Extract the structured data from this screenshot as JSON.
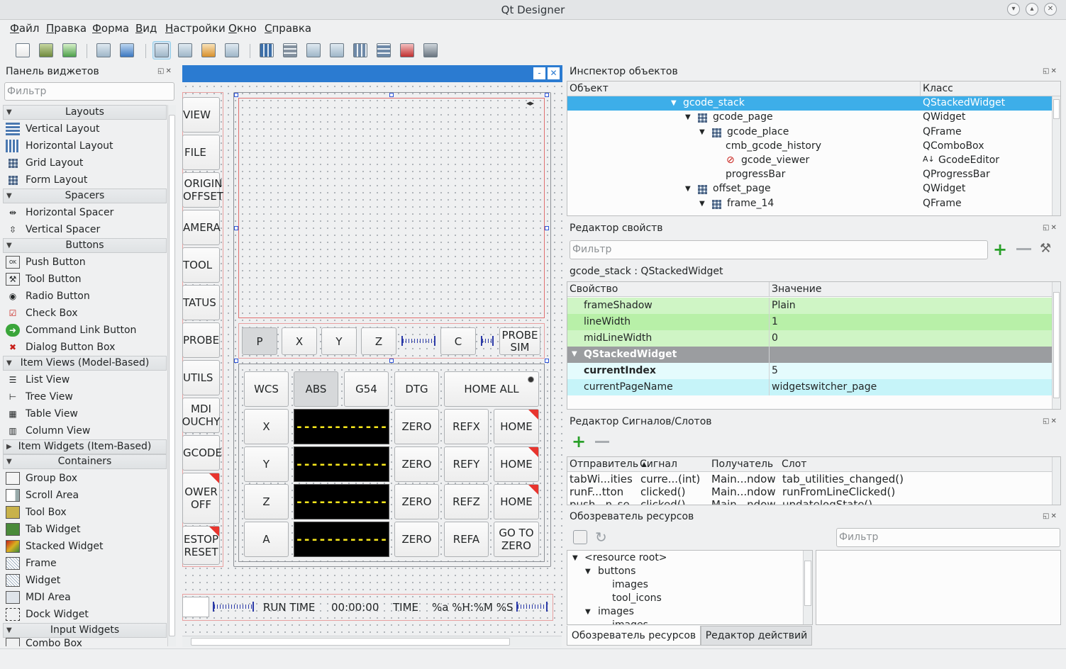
{
  "window": {
    "title": "Qt Designer"
  },
  "menu": [
    "Файл",
    "Правка",
    "Форма",
    "Вид",
    "Настройки",
    "Окно",
    "Справка"
  ],
  "widget_box": {
    "title": "Панель виджетов",
    "filter_placeholder": "Фильтр",
    "categories": {
      "layouts": "Layouts",
      "spacers": "Spacers",
      "buttons": "Buttons",
      "item_views": "Item Views (Model-Based)",
      "item_widgets": "Item Widgets (Item-Based)",
      "containers": "Containers",
      "input_widgets": "Input Widgets"
    },
    "layouts": [
      "Vertical Layout",
      "Horizontal Layout",
      "Grid Layout",
      "Form Layout"
    ],
    "spacers": [
      "Horizontal Spacer",
      "Vertical Spacer"
    ],
    "buttons": [
      "Push Button",
      "Tool Button",
      "Radio Button",
      "Check Box",
      "Command Link Button",
      "Dialog Button Box"
    ],
    "item_views": [
      "List View",
      "Tree View",
      "Table View",
      "Column View"
    ],
    "containers": [
      "Group Box",
      "Scroll Area",
      "Tool Box",
      "Tab Widget",
      "Stacked Widget",
      "Frame",
      "Widget",
      "MDI Area",
      "Dock Widget"
    ],
    "input_widgets": [
      "Combo Box"
    ]
  },
  "form": {
    "side_buttons": [
      "VIEW",
      "FILE",
      "ORIGIN\nOFFSET",
      "AMERA",
      "TOOL",
      "TATUS",
      "PROBE",
      "UTILS",
      "MDI\nOUCHY",
      "GCODE",
      "OWER\nOFF",
      "ESTOP\nRESET"
    ],
    "axis_bar": [
      "P",
      "X",
      "Y",
      "Z",
      "C",
      "PROBE\nSIM"
    ],
    "top_row": [
      "WCS",
      "ABS",
      "G54",
      "DTG",
      "HOME ALL"
    ],
    "axes": [
      "X",
      "Y",
      "Z",
      "A"
    ],
    "dro_value": "------------",
    "zero": "ZERO",
    "refs": [
      "REFX",
      "REFY",
      "REFZ",
      "REFA"
    ],
    "homes": [
      "HOME",
      "HOME",
      "HOME",
      "GO TO\nZERO"
    ],
    "status": {
      "run_time_label": "RUN TIME",
      "run_time": "00:00:00",
      "time_label": "TIME",
      "time_fmt": "%a %H:%M %S"
    }
  },
  "object_inspector": {
    "title": "Инспектор объектов",
    "col_object": "Объект",
    "col_class": "Класс",
    "rows": [
      {
        "name": "gcode_stack",
        "cls": "QStackedWidget"
      },
      {
        "name": "gcode_page",
        "cls": "QWidget"
      },
      {
        "name": "gcode_place",
        "cls": "QFrame"
      },
      {
        "name": "cmb_gcode_history",
        "cls": "QComboBox"
      },
      {
        "name": "gcode_viewer",
        "cls": "GcodeEditor"
      },
      {
        "name": "progressBar",
        "cls": "QProgressBar"
      },
      {
        "name": "offset_page",
        "cls": "QWidget"
      },
      {
        "name": "frame_14",
        "cls": "QFrame"
      }
    ]
  },
  "property_editor": {
    "title": "Редактор свойств",
    "filter_placeholder": "Фильтр",
    "object_label": "gcode_stack : QStackedWidget",
    "col_prop": "Свойство",
    "col_value": "Значение",
    "rows": [
      {
        "k": "frameShadow",
        "v": "Plain"
      },
      {
        "k": "lineWidth",
        "v": "1"
      },
      {
        "k": "midLineWidth",
        "v": "0"
      },
      {
        "k": "QStackedWidget",
        "v": ""
      },
      {
        "k": "currentIndex",
        "v": "5"
      },
      {
        "k": "currentPageName",
        "v": "widgetswitcher_page"
      }
    ]
  },
  "signal_slot": {
    "title": "Редактор Сигналов/Слотов",
    "cols": [
      "Отправитель",
      "Сигнал",
      "Получатель",
      "Слот"
    ],
    "rows": [
      {
        "s": "tabWi...ities",
        "sig": "curre...(int)",
        "r": "Main...ndow",
        "slot": "tab_utilities_changed()"
      },
      {
        "s": "runF...tton",
        "sig": "clicked()",
        "r": "Main...ndow",
        "slot": "runFromLineClicked()"
      },
      {
        "s": "push...n_se",
        "sig": "clicked()",
        "r": "Main...ndow",
        "slot": "updatelogState()"
      }
    ]
  },
  "resource_browser": {
    "title": "Обозреватель ресурсов",
    "filter_placeholder": "Фильтр",
    "tree": [
      "<resource root>",
      "buttons",
      "images",
      "tool_icons",
      "images",
      "images"
    ],
    "tabs": [
      "Обозреватель ресурсов",
      "Редактор действий"
    ]
  },
  "colors": {
    "selection": "#3daee9",
    "green_row": "#cff5c5",
    "cyan_row": "#d2f8fb",
    "section": "#9b9da0",
    "lcd_text": "#f6e61c",
    "red_corner": "#e8352e"
  }
}
